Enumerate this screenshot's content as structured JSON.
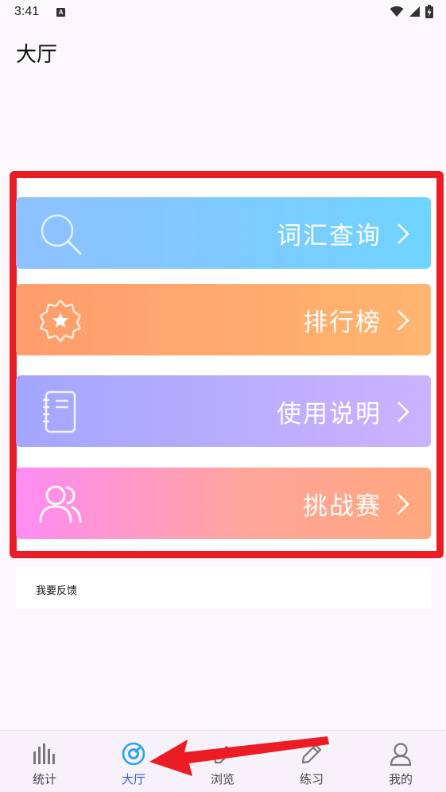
{
  "status_bar": {
    "time": "3:41",
    "badge": "A"
  },
  "header": {
    "title": "大厅"
  },
  "cards": [
    {
      "label": "词汇查询",
      "icon": "search-icon"
    },
    {
      "label": "排行榜",
      "icon": "star-badge-icon"
    },
    {
      "label": "使用说明",
      "icon": "notebook-icon"
    },
    {
      "label": "挑战赛",
      "icon": "users-icon"
    }
  ],
  "feedback": {
    "label": "我要反馈"
  },
  "bottom_nav": {
    "items": [
      {
        "label": "统计",
        "icon": "bar-chart-icon"
      },
      {
        "label": "大厅",
        "icon": "compass-icon",
        "active": true
      },
      {
        "label": "浏览",
        "icon": "browse-icon"
      },
      {
        "label": "练习",
        "icon": "pencil-icon"
      },
      {
        "label": "我的",
        "icon": "profile-icon"
      }
    ]
  },
  "colors": {
    "annotation_red": "#ec1c24",
    "active_nav": "#2aa4f4"
  }
}
